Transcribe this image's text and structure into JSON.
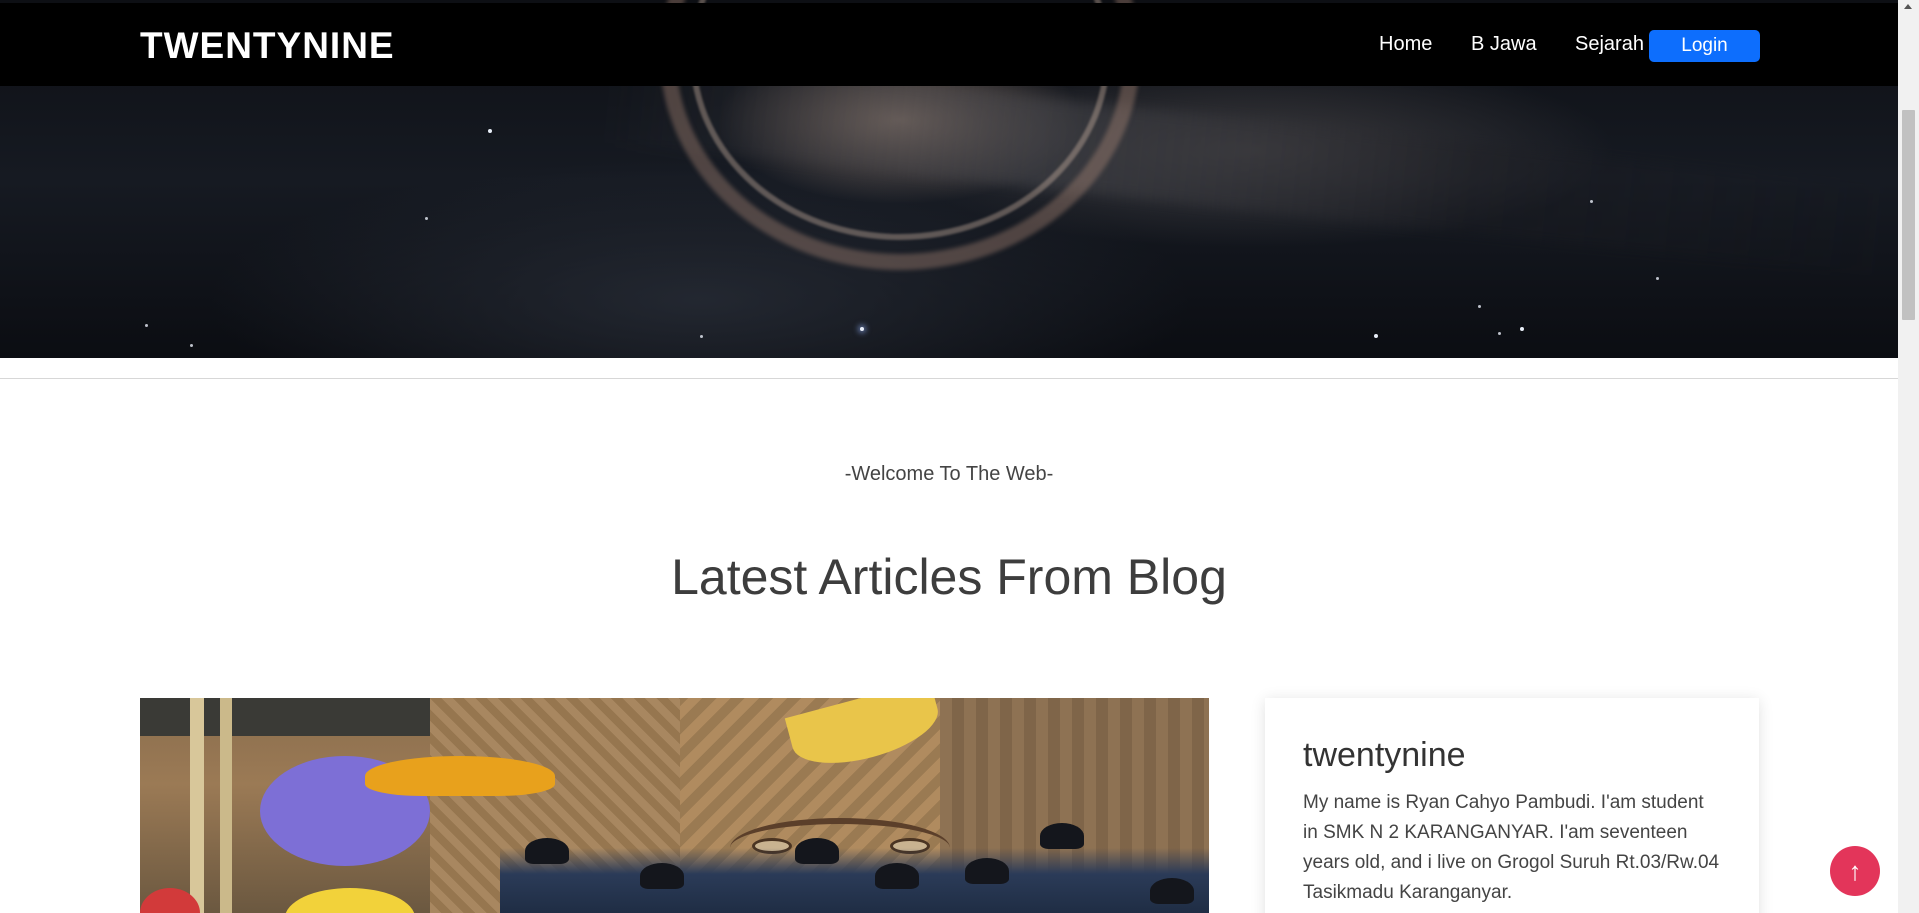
{
  "navbar": {
    "brand": "TWENTYNINE",
    "links": [
      "Home",
      "B Jawa",
      "Sejarah"
    ],
    "login_label": "Login"
  },
  "main": {
    "welcome": "-Welcome To The Web-",
    "section_title": "Latest Articles From Blog"
  },
  "sidebar_card": {
    "title": "twentynine",
    "text": "My name is Ryan Cahyo Pambudi. I'am student in SMK N 2 KARANGANYAR. I'am seventeen years old, and i live on Grogol Suruh Rt.03/Rw.04 Tasikmadu Karanganyar."
  },
  "back_to_top": {
    "icon": "arrow-up-icon",
    "glyph": "↑"
  },
  "colors": {
    "navbar_bg": "#000000",
    "login_button": "#0d6efd",
    "back_to_top": "#e3355a"
  }
}
